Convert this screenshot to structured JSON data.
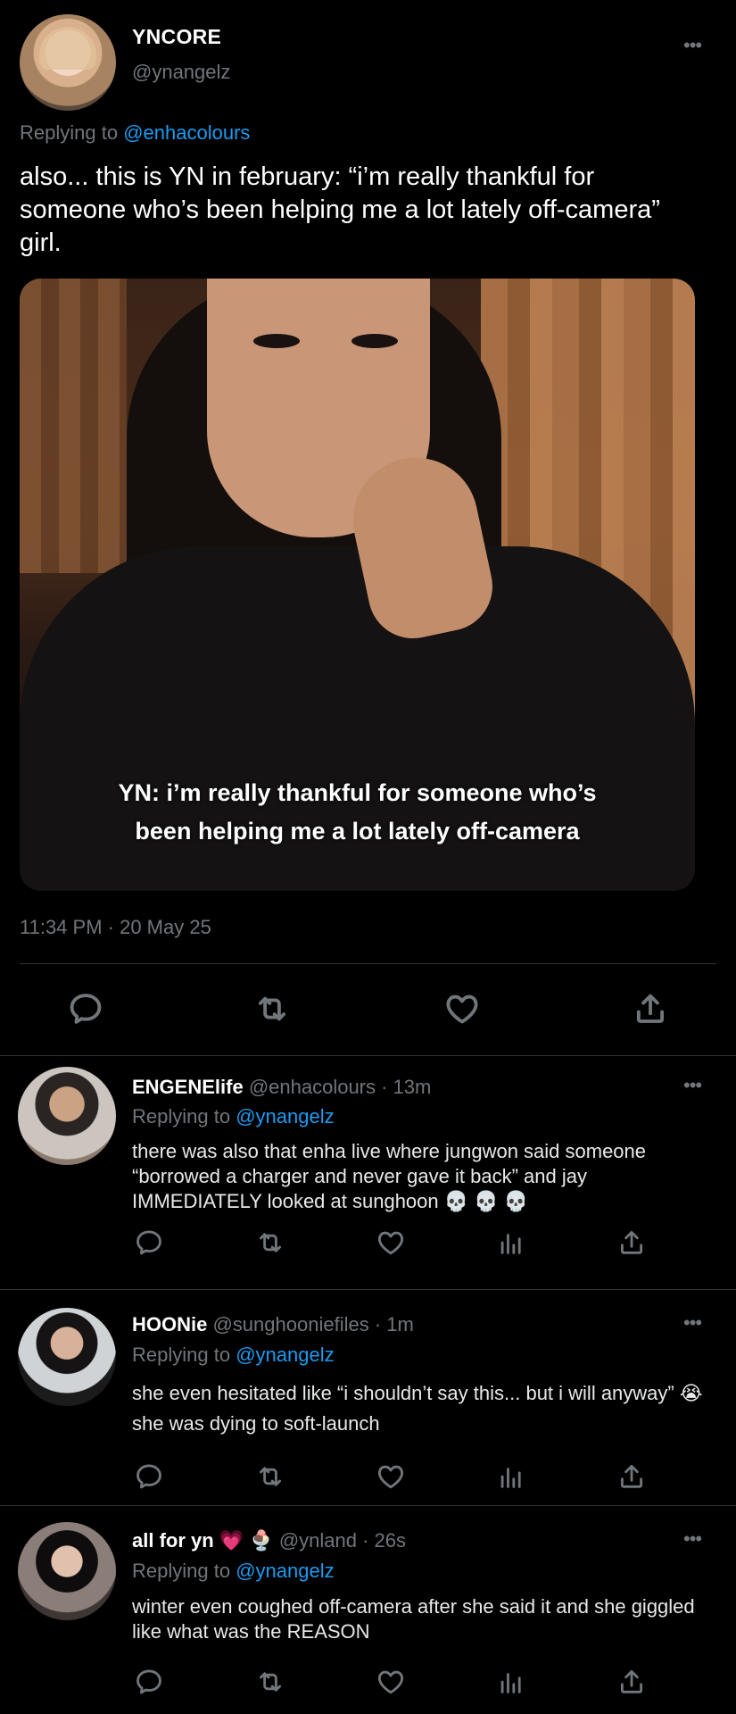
{
  "main": {
    "display_name": "YNCORE",
    "handle": "@ynangelz",
    "replying_prefix": "Replying to",
    "replying_to": "@enhacolours",
    "text": "also... this is YN in february: “i’m really thankful for someone who’s been helping me a lot lately off-camera” girl.",
    "image_caption_line1": "YN: i’m really thankful for someone who’s",
    "image_caption_line2": "been helping me a lot lately off-camera",
    "timestamp": "11:34 PM · 20 May 25",
    "more": "•••"
  },
  "replies": [
    {
      "display_name": "ENGENElife",
      "meta": " @enhacolours · 13m",
      "replying_prefix": "Replying to",
      "replying_to": "@ynangelz",
      "text": "there was also that enha live where jungwon said someone “borrowed a charger and never gave it back” and jay IMMEDIATELY looked at sunghoon 💀 💀 💀",
      "more": "•••"
    },
    {
      "display_name": "HOONie",
      "meta": " @sunghooniefiles · 1m",
      "replying_prefix": "Replying to",
      "replying_to": "@ynangelz",
      "text": "she even hesitated like “i shouldn’t say this... but i will anyway” 😭  she was dying to soft-launch",
      "more": "•••"
    },
    {
      "display_name": "all for yn",
      "name_emoji": " 💗 🍨",
      "meta": "  @ynland · 26s",
      "replying_prefix": "Replying to",
      "replying_to": "@ynangelz",
      "text": "winter even coughed off-camera  after she said it and she giggled like what was the REASON",
      "more": "•••"
    }
  ],
  "icons": {
    "reply": "reply-icon",
    "retweet": "retweet-icon",
    "like": "heart-icon",
    "views": "views-icon",
    "share": "share-icon",
    "more": "more-icon"
  },
  "colors": {
    "background": "#000000",
    "link": "#1d9bf0",
    "muted": "#71767b",
    "text": "#e7e9ea",
    "divider": "#2f3336"
  }
}
